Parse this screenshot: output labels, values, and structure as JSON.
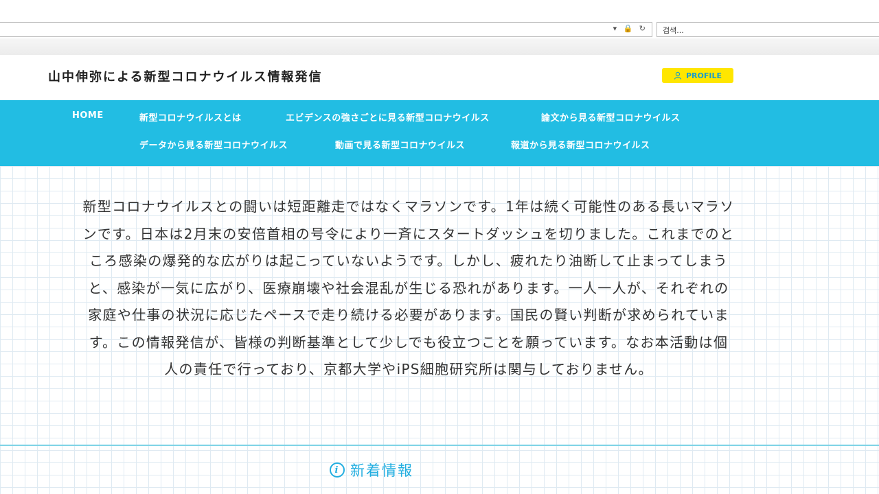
{
  "browser": {
    "search_placeholder": "검색..."
  },
  "header": {
    "title": "山中伸弥による新型コロナウイルス情報発信",
    "profile_label": "PROFILE"
  },
  "nav": {
    "items": [
      "HOME",
      "新型コロナウイルスとは",
      "エビデンスの強さごとに見る新型コロナウイルス",
      "論文から見る新型コロナウイルス",
      "データから見る新型コロナウイルス",
      "動画で見る新型コロナウイルス",
      "報道から見る新型コロナウイルス"
    ]
  },
  "main": {
    "intro_text": "新型コロナウイルスとの闘いは短距離走ではなくマラソンです。1年は続く可能性のある長いマラソンです。日本は2月末の安倍首相の号令により一斉にスタートダッシュを切りました。これまでのところ感染の爆発的な広がりは起こっていないようです。しかし、疲れたり油断して止まってしまうと、感染が一気に広がり、医療崩壊や社会混乱が生じる恐れがあります。一人一人が、それぞれの家庭や仕事の状況に応じたペースで走り続ける必要があります。国民の賢い判断が求められています。この情報発信が、皆様の判断基準として少しでも役立つことを願っています。なお本活動は個人の責任で行っており、京都大学やiPS細胞研究所は関与しておりません。",
    "news_heading": "新着情報"
  },
  "colors": {
    "nav_bg": "#22bde3",
    "profile_bg": "#ffe600",
    "accent": "#22aee0"
  }
}
